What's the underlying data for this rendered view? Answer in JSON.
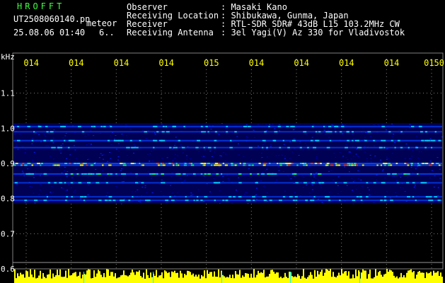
{
  "header": {
    "brand": "HROFFT",
    "filename": "UT2508060140.pn",
    "mode": "meteor",
    "datetime": "25.08.06 01:40",
    "count": "6.."
  },
  "metadata": [
    {
      "label": "Observer",
      "value": ": Masaki Kano"
    },
    {
      "label": "Receiving Location",
      "value": ": Shibukawa, Gunma, Japan"
    },
    {
      "label": "Receiver",
      "value": ": RTL-SDR SDR# 43dB L15 103.2MHz CW"
    },
    {
      "label": "Receiving Antenna",
      "value": ": 3el Yagi(V) Az 330 for Vladivostok"
    }
  ],
  "colors": {
    "background": "#000000",
    "header_brand": "#3cff3c",
    "time_labels": "#ffff00",
    "grid": "#808080",
    "amplitude_bars": "#ffff00"
  },
  "chart_data": {
    "type": "heatmap",
    "ylabel": "kHz",
    "y_ticks": [
      "1.1",
      "1.0",
      "0.9",
      "0.8",
      "0.7",
      "0.6"
    ],
    "y_tick_values": [
      1.1,
      1.0,
      0.9,
      0.8,
      0.7,
      0.6
    ],
    "ylim": [
      0.6,
      1.2
    ],
    "x_ticks": [
      "014",
      "014",
      "014",
      "014",
      "015",
      "014",
      "014",
      "014",
      "014",
      "0150"
    ],
    "grid": true,
    "noise_band_khz": [
      0.785,
      1.015
    ],
    "signal_lines_khz": [
      {
        "freq": 1.005,
        "strength": 0.45
      },
      {
        "freq": 0.99,
        "strength": 0.4
      },
      {
        "freq": 0.965,
        "strength": 0.55
      },
      {
        "freq": 0.945,
        "strength": 0.5
      },
      {
        "freq": 0.9,
        "strength": 0.95
      },
      {
        "freq": 0.895,
        "strength": 0.85
      },
      {
        "freq": 0.87,
        "strength": 0.7
      },
      {
        "freq": 0.845,
        "strength": 0.45
      },
      {
        "freq": 0.805,
        "strength": 0.4
      },
      {
        "freq": 0.795,
        "strength": 0.55
      }
    ]
  }
}
